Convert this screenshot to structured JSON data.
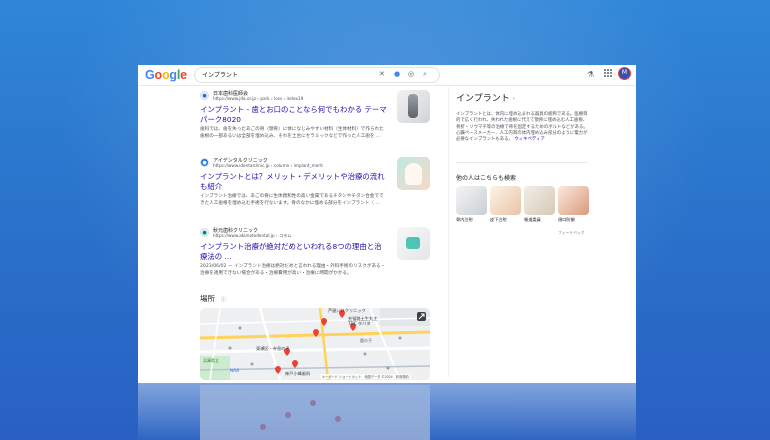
{
  "header": {
    "logo_text": "Google",
    "search_query": "インプラント",
    "icons": [
      "clear-icon",
      "microphone-icon",
      "lens-icon",
      "search-icon",
      "labs-flask-icon",
      "apps-grid-icon"
    ],
    "avatar_letter": "M"
  },
  "results": [
    {
      "site_name": "日本歯科医師会",
      "url": "https://www.jda.or.jp › park › loss › index19",
      "title": "インプラント - 歯とお口のことなら何でもわかる テーマパーク8020",
      "snippet": "歯科では、歯を失ったあごの骨（顎骨）に体になじみやすい材料（生体材料）で作られた歯根の一部あるいは全部を埋め込み、それを土台にセラミックなどで作った人工歯を ..."
    },
    {
      "site_name": "アイデンタルクリニック",
      "url": "https://www.identalclinic.jp › column › implant_merit",
      "title": "インプラントとは？メリット・デメリットや治療の流れも紹介",
      "snippet": "インプラント治療では、あごの骨に生体親和性の高い金属であるチタンやチタン合金でできた人工歯根を埋め込む手術を行ないます。骨のなかに埋める部分をインプラント（ ..."
    },
    {
      "site_name": "秋元歯科クリニック",
      "url": "https://www.akimotodental.jp › コラム",
      "title": "インプラント治療が絶対だめといわれる8つの理由と治療法の ...",
      "snippet": "2023/06/02 — インプラント治療は絶対だめと言われる理由・外科手術のリスクがある・治療を適用できない場合がある・治療費用が高い・治療に時間がかかる。"
    }
  ],
  "places": {
    "title": "場所",
    "map_labels": [
      "芦屋ｼﾝﾀﾙクリニック",
      "芸留路土生丸主",
      "TDC タバタ",
      "東瀬区・寺島の予",
      "神戸小峰歯科",
      "兵庫県立",
      "鹿の子",
      "NAVI"
    ],
    "attribution": "キーボード ショートカット　地図データ ©2024　利用規約"
  },
  "knowledge_panel": {
    "title": "インプラント",
    "description": "インプラントとは、体内に埋め込まれる器具の総称である。医療目的で広く行われ、失われた歯根に代えて顎骨に埋め込む人工歯根、骨折・リウマチ等の治療で骨を固定するためのボルトなどがある。心臓ペースメーカー、人工内耳の体内埋め込み部分のように電力が必要なインプラントもある。",
    "source_link": "ウィキペディア",
    "related_heading": "他の人はこちらも検索",
    "related": [
      "骨内注射",
      "皮下注射",
      "報道委員",
      "顔口防御"
    ],
    "feedback": "フィードバック"
  }
}
